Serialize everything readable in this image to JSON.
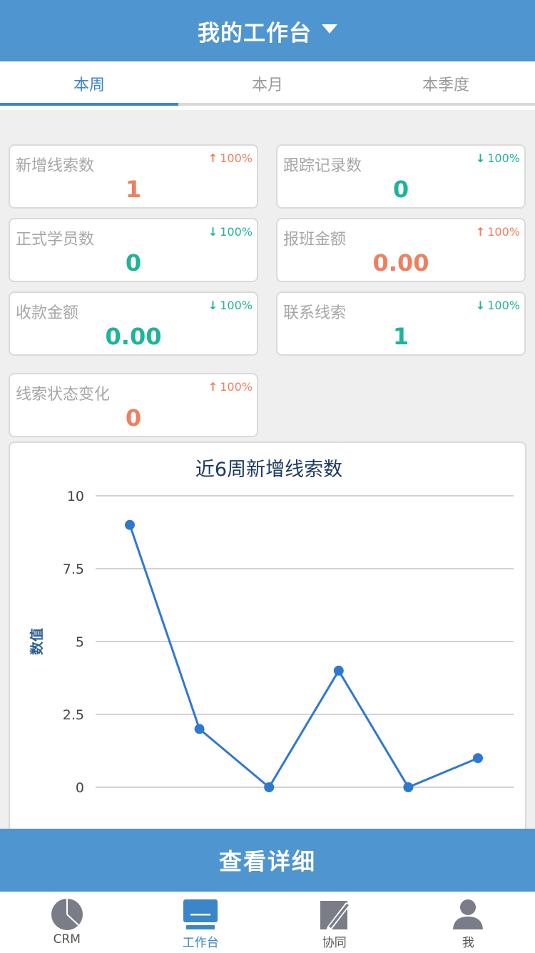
{
  "header": {
    "title": "我的工作台"
  },
  "tabs": [
    {
      "label": "本周",
      "active": true
    },
    {
      "label": "本月",
      "active": false
    },
    {
      "label": "本季度",
      "active": false
    }
  ],
  "stats": [
    {
      "label": "新增线索数",
      "trend": "up",
      "trend_arrow": "↑",
      "percent": "100%",
      "value": "1"
    },
    {
      "label": "跟踪记录数",
      "trend": "down",
      "trend_arrow": "↓",
      "percent": "100%",
      "value": "0"
    },
    {
      "label": "正式学员数",
      "trend": "down",
      "trend_arrow": "↓",
      "percent": "100%",
      "value": "0"
    },
    {
      "label": "报班金额",
      "trend": "up",
      "trend_arrow": "↑",
      "percent": "100%",
      "value": "0.00"
    },
    {
      "label": "收款金额",
      "trend": "down",
      "trend_arrow": "↓",
      "percent": "100%",
      "value": "0.00"
    },
    {
      "label": "联系线索",
      "trend": "down",
      "trend_arrow": "↓",
      "percent": "100%",
      "value": "1"
    },
    {
      "label": "线索状态变化",
      "trend": "up",
      "trend_arrow": "↑",
      "percent": "100%",
      "value": "0"
    }
  ],
  "chart_data": {
    "type": "line",
    "title": "近6周新增线索数",
    "ylabel": "数值",
    "xlabel": "",
    "ylim": [
      0,
      10
    ],
    "yticks": [
      "10",
      "7.5",
      "5",
      "2.5",
      "0"
    ],
    "ytick_values": [
      10,
      7.5,
      5,
      2.5,
      0
    ],
    "x": [
      1,
      2,
      3,
      4,
      5,
      6
    ],
    "values": [
      9,
      2,
      0,
      4,
      0,
      1
    ],
    "grid": true,
    "color": "#2f78d0"
  },
  "detail_button": {
    "label": "查看详细"
  },
  "tabbar": [
    {
      "label": "CRM",
      "icon": "pie-chart-icon",
      "active": false
    },
    {
      "label": "工作台",
      "icon": "monitor-icon",
      "active": true
    },
    {
      "label": "协同",
      "icon": "pencil-note-icon",
      "active": false
    },
    {
      "label": "我",
      "icon": "user-icon",
      "active": false
    }
  ],
  "colors": {
    "brand": "#4f95cf",
    "up": "#ee7f5f",
    "down": "#1fb39b",
    "active_tab": "#3b86c8"
  }
}
